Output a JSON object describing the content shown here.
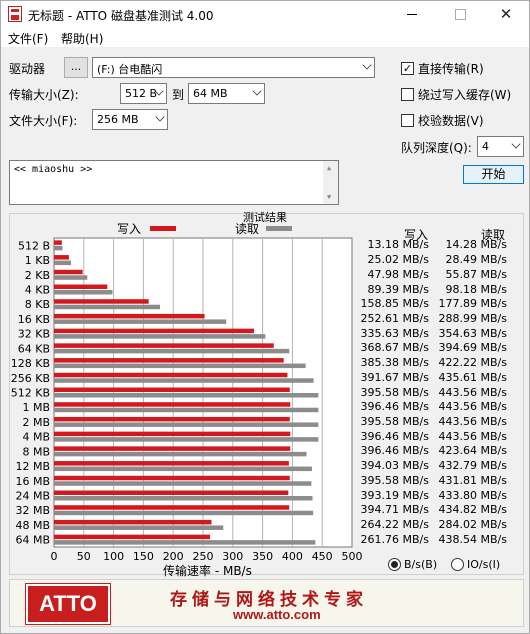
{
  "window": {
    "title": "无标题 - ATTO 磁盘基准测试 4.00",
    "close_glyph": "✕"
  },
  "menu": [
    "文件(F)",
    "帮助(H)"
  ],
  "controls": {
    "drive_label": "驱动器",
    "drive_browse": "...",
    "drive_value": "(F:) 台电酷闪",
    "transfer_label": "传输大小(Z):",
    "transfer_from": "512 B",
    "to_label": "到",
    "transfer_to": "64 MB",
    "filesize_label": "文件大小(F):",
    "filesize_value": "256 MB",
    "direct_io": "直接传输(R)",
    "direct_io_checked": true,
    "bypass_cache": "绕过写入缓存(W)",
    "bypass_cache_checked": false,
    "verify": "校验数据(V)",
    "verify_checked": false,
    "queue_label": "队列深度(Q):",
    "queue_value": "4",
    "start_button": "开始",
    "description": "<< miaoshu >>",
    "checkmark": "✓"
  },
  "chart_data": {
    "type": "bar",
    "title": "测试结果",
    "legend": {
      "write": "写入",
      "read": "读取"
    },
    "column_headers": {
      "write": "写入",
      "read": "读取"
    },
    "xlabel": "传输速率 - MB/s",
    "xlim": [
      0,
      500
    ],
    "xticks": [
      "0",
      "50",
      "100",
      "150",
      "200",
      "250",
      "300",
      "350",
      "400",
      "450",
      "500"
    ],
    "grid": true,
    "categories": [
      "512 B",
      "1 KB",
      "2 KB",
      "4 KB",
      "8 KB",
      "16 KB",
      "32 KB",
      "64 KB",
      "128 KB",
      "256 KB",
      "512 KB",
      "1 MB",
      "2 MB",
      "4 MB",
      "8 MB",
      "12 MB",
      "16 MB",
      "24 MB",
      "32 MB",
      "48 MB",
      "64 MB"
    ],
    "series": [
      {
        "name": "写入",
        "color": "#d2191e",
        "values": [
          13.18,
          25.02,
          47.98,
          89.39,
          158.85,
          252.61,
          335.63,
          368.67,
          385.38,
          391.67,
          395.58,
          396.46,
          395.58,
          396.46,
          396.46,
          394.03,
          395.58,
          393.19,
          394.71,
          264.22,
          261.76
        ],
        "labels": [
          "13.18 MB/s",
          "25.02 MB/s",
          "47.98 MB/s",
          "89.39 MB/s",
          "158.85 MB/s",
          "252.61 MB/s",
          "335.63 MB/s",
          "368.67 MB/s",
          "385.38 MB/s",
          "391.67 MB/s",
          "395.58 MB/s",
          "396.46 MB/s",
          "395.58 MB/s",
          "396.46 MB/s",
          "396.46 MB/s",
          "394.03 MB/s",
          "395.58 MB/s",
          "393.19 MB/s",
          "394.71 MB/s",
          "264.22 MB/s",
          "261.76 MB/s"
        ]
      },
      {
        "name": "读取",
        "color": "#8c8c8c",
        "values": [
          14.28,
          28.49,
          55.87,
          98.18,
          177.89,
          288.99,
          354.63,
          394.69,
          422.22,
          435.61,
          443.56,
          443.56,
          443.56,
          443.56,
          423.64,
          432.79,
          431.81,
          433.8,
          434.82,
          284.02,
          438.54
        ],
        "labels": [
          "14.28 MB/s",
          "28.49 MB/s",
          "55.87 MB/s",
          "98.18 MB/s",
          "177.89 MB/s",
          "288.99 MB/s",
          "354.63 MB/s",
          "394.69 MB/s",
          "422.22 MB/s",
          "435.61 MB/s",
          "443.56 MB/s",
          "443.56 MB/s",
          "443.56 MB/s",
          "443.56 MB/s",
          "423.64 MB/s",
          "432.79 MB/s",
          "431.81 MB/s",
          "433.80 MB/s",
          "434.82 MB/s",
          "284.02 MB/s",
          "438.54 MB/s"
        ]
      }
    ]
  },
  "units": {
    "bytes_per_sec": "B/s(B)",
    "io_per_sec": "IO/s(I)",
    "selected": "bytes_per_sec"
  },
  "banner": {
    "logo": "ATTO",
    "slogan": "存储与网络技术专家",
    "url": "www.atto.com"
  }
}
